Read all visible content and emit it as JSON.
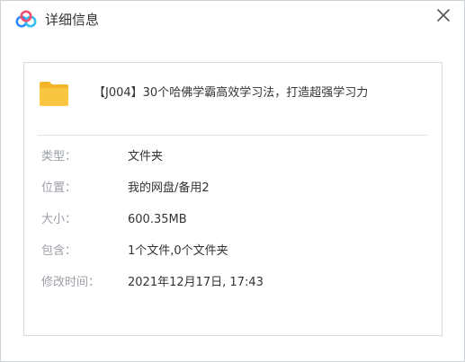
{
  "window": {
    "title": "详细信息",
    "close_icon": "close-icon",
    "logo_icon": "baidu-netdisk-logo-icon"
  },
  "file": {
    "icon": "folder-icon",
    "name": "【J004】30个哈佛学霸高效学习法，打造超强学习力"
  },
  "details": [
    {
      "label": "类型：",
      "value": "文件夹"
    },
    {
      "label": "位置：",
      "value": "我的网盘/备用2"
    },
    {
      "label": "大小：",
      "value": "600.35MB"
    },
    {
      "label": "包含：",
      "value": "1个文件,0个文件夹"
    },
    {
      "label": "修改时间：",
      "value": "2021年12月17日, 17:43"
    }
  ],
  "colors": {
    "label": "#9a9ea6",
    "value": "#333333",
    "folder": "#f9c642",
    "logo_blue": "#2f8cff",
    "logo_pink": "#f2506e"
  }
}
